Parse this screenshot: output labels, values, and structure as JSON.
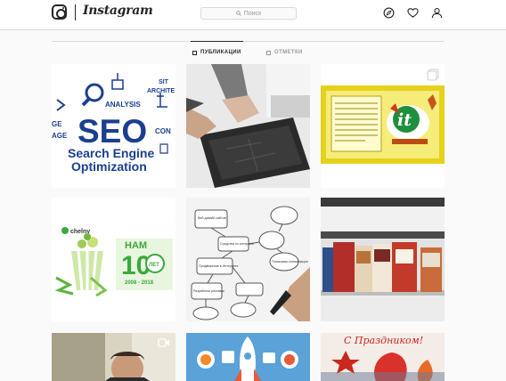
{
  "header": {
    "brand": "Instagram",
    "search_placeholder": "Поиск",
    "icons": [
      "instagram-logo-icon",
      "compass-icon",
      "heart-icon",
      "user-icon"
    ]
  },
  "tabs": [
    {
      "label": "ПУБЛИКАЦИИ",
      "active": true,
      "icon": "grid-icon"
    },
    {
      "label": "ОТМЕТКИ",
      "active": false,
      "icon": "tag-icon"
    }
  ],
  "posts": [
    {
      "description": "seo-illustration",
      "title_main": "SEO",
      "title_line1": "Search Engine",
      "title_line2": "Optimization",
      "words": [
        "ANALYSIS",
        "SIT",
        "ARCHITE",
        "CON",
        "GE",
        "AGE"
      ]
    },
    {
      "description": "hands-on-tablet-photo"
    },
    {
      "description": "it-diploma-card",
      "logo_text": "it",
      "badge_icon": "carousel-icon"
    },
    {
      "description": "chelny-anniversary",
      "brand": "chelny",
      "line1": "НАМ",
      "number": "10",
      "suffix": "ЛЕТ",
      "years": "2008 - 2018"
    },
    {
      "description": "flowchart-drawing",
      "boxes": [
        "Веб-дизайн сайтов",
        "Средства по контролю",
        "Продвижение в Интернете",
        "Разработка рекламы",
        "Поисковая оптимизация"
      ]
    },
    {
      "description": "books-on-shelf-photo"
    },
    {
      "description": "man-in-office-photo",
      "badge_icon": "video-icon"
    },
    {
      "description": "rocket-launch-illustration"
    },
    {
      "description": "holiday-greeting-card",
      "text": "С Праздником!"
    }
  ],
  "colors": {
    "seo_blue": "#1b3f8f",
    "it_green": "#1e8f3a",
    "card_yellow": "#e6d11d",
    "chelny_green": "#3aa83a",
    "holiday_red": "#c9281e"
  }
}
